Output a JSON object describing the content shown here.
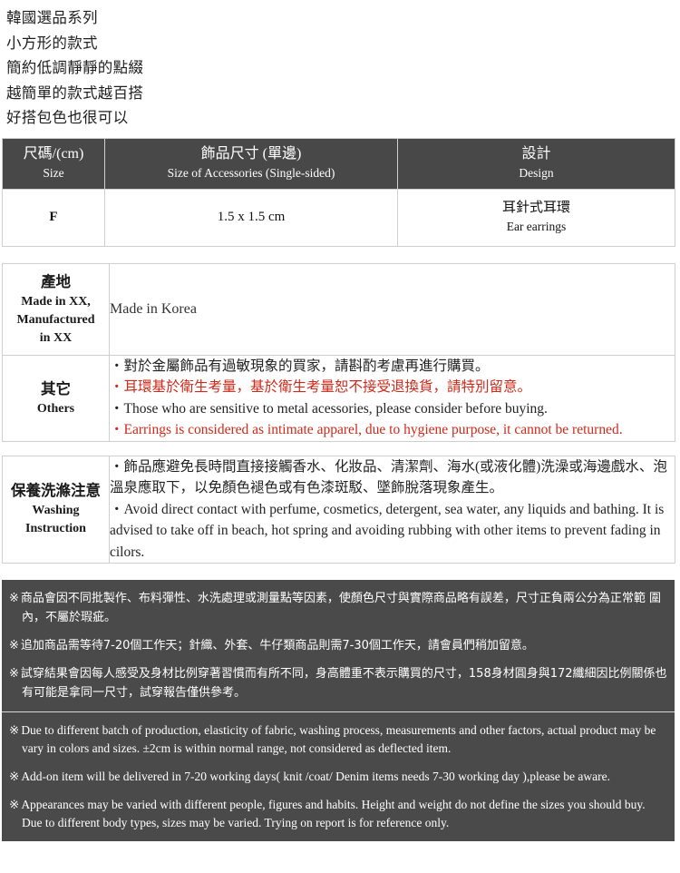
{
  "intro": {
    "lines": [
      "韓國選品系列",
      "小方形的款式",
      "簡約低調靜靜的點綴",
      "越簡單的款式越百搭",
      "好搭包色也很可以"
    ]
  },
  "size_table": {
    "headers": [
      {
        "cn": "尺碼/(cm)",
        "en": "Size"
      },
      {
        "cn": "飾品尺寸 (單邊)",
        "en": "Size of Accessories (Single-sided)"
      },
      {
        "cn": "設計",
        "en": "Design"
      }
    ],
    "row": {
      "size": "F",
      "measurement": "1.5 x 1.5 cm",
      "design_cn": "耳針式耳環",
      "design_en": "Ear earrings"
    }
  },
  "info_table": {
    "origin": {
      "label_cn": "產地",
      "label_en_line1": "Made in XX,",
      "label_en_line2": "Manufactured",
      "label_en_line3": "in XX",
      "value": "Made in Korea"
    },
    "others": {
      "label_cn": "其它",
      "label_en": "Others",
      "lines": [
        {
          "text": "・對於金屬飾品有過敏現象的買家，請斟酌考慮再進行購買。",
          "color": "dark"
        },
        {
          "text": "・耳環基於衛生考量，基於衛生考量恕不接受退換貨，請特別留意。",
          "color": "red"
        },
        {
          "text": "・Those who are sensitive to metal acessories, please consider before buying.",
          "color": "dark"
        },
        {
          "text": "・Earrings is considered as intimate apparel, due to hygiene purpose, it cannot be returned.",
          "color": "red"
        }
      ]
    }
  },
  "washing_table": {
    "label_cn": "保養洗滌注意",
    "label_en_line1": "Washing",
    "label_en_line2": "Instruction",
    "lines": [
      "・飾品應避免長時間直接接觸香水、化妝品、清潔劑、海水(或液化體)洗澡或海邊戲水、泡溫泉應取下，以免顏色褪色或有色漆斑駁、墜飾脫落現象產生。",
      "・Avoid direct contact with perfume, cosmetics, detergent, sea water, any liquids and bathing. It is advised to take off in beach, hot spring and avoiding rubbing with other items to prevent fading in cilors."
    ]
  },
  "notices": {
    "mark": "※",
    "chinese": [
      "商品會因不同批製作、布料彈性、水洗處理或測量點等因素，使顏色尺寸與實際商品略有誤差，尺寸正負兩公分為正常範 圍內，不屬於瑕疵。",
      "追加商品需等待7-20個工作天；針織、外套、牛仔類商品則需7-30個工作天，請會員們稍加留意。",
      "試穿結果會因每人感受及身材比例穿著習慣而有所不同，身高體重不表示購買的尺寸，158身材圓身與172纖細因比例關係也有可能是拿同一尺寸，試穿報告僅供參考。"
    ],
    "english": [
      "Due to different batch of production, elasticity of fabric, washing process, measurements and other factors, actual product may be vary in colors and sizes. ±2cm is within normal range, not considered as deflected item.",
      "Add-on item will be delivered in 7-20 working days( knit /coat/ Denim items needs 7-30 working day ),please be aware.",
      "Appearances may be varied with different people, figures and habits. Height and weight do not define the sizes you should buy. Due to different body types, sizes may be varied. Trying on report is for reference only."
    ]
  },
  "colors": {
    "header_bg": "#484848",
    "notice_bg": "#4a4a4a",
    "red_text": "#cc2a1a",
    "border": "#cfcfcf"
  }
}
